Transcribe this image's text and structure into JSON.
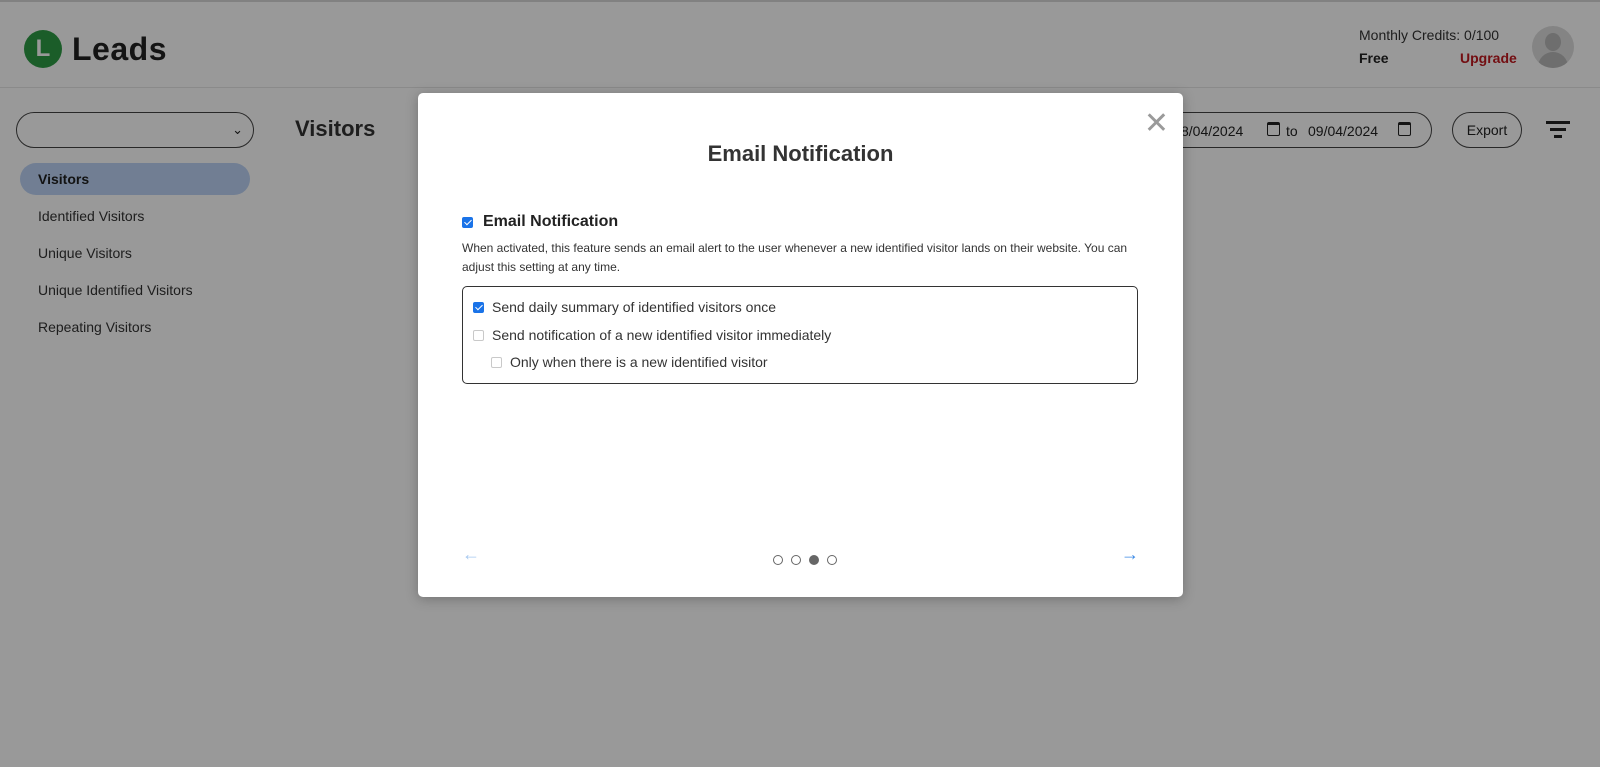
{
  "header": {
    "logo_letter": "L",
    "logo_text": "Leads",
    "credits": "Monthly Credits: 0/100",
    "plan": "Free",
    "upgrade": "Upgrade"
  },
  "sidebar": {
    "site_select_value": "",
    "items": [
      {
        "label": "Visitors",
        "active": true
      },
      {
        "label": "Identified Visitors",
        "active": false
      },
      {
        "label": "Unique Visitors",
        "active": false
      },
      {
        "label": "Unique Identified Visitors",
        "active": false
      },
      {
        "label": "Repeating Visitors",
        "active": false
      }
    ]
  },
  "main": {
    "title": "Visitors",
    "date_from": "8/04/2024",
    "date_to_label": "to",
    "date_to": "09/04/2024",
    "export_label": "Export"
  },
  "modal": {
    "close_glyph": "✕",
    "title": "Email Notification",
    "main_option": {
      "label": "Email Notification",
      "checked": true
    },
    "description": "When activated, this feature sends an email alert to the user whenever a new identified visitor lands on their website. You can adjust this setting at any time.",
    "options": [
      {
        "label": "Send daily summary of identified visitors once",
        "checked": true
      },
      {
        "label": "Send notification of a new identified visitor immediately",
        "checked": false
      },
      {
        "label": "Only when there is a new identified visitor",
        "checked": false
      }
    ],
    "prev_glyph": "←",
    "next_glyph": "→",
    "pagination": {
      "total": 4,
      "current": 3
    }
  },
  "colors": {
    "brand_green": "#2e9b45",
    "upgrade_red": "#c0181e",
    "active_nav": "#bcd3f5",
    "checkbox_blue": "#1a73e8",
    "arrow_blue": "#3b8ae6"
  }
}
